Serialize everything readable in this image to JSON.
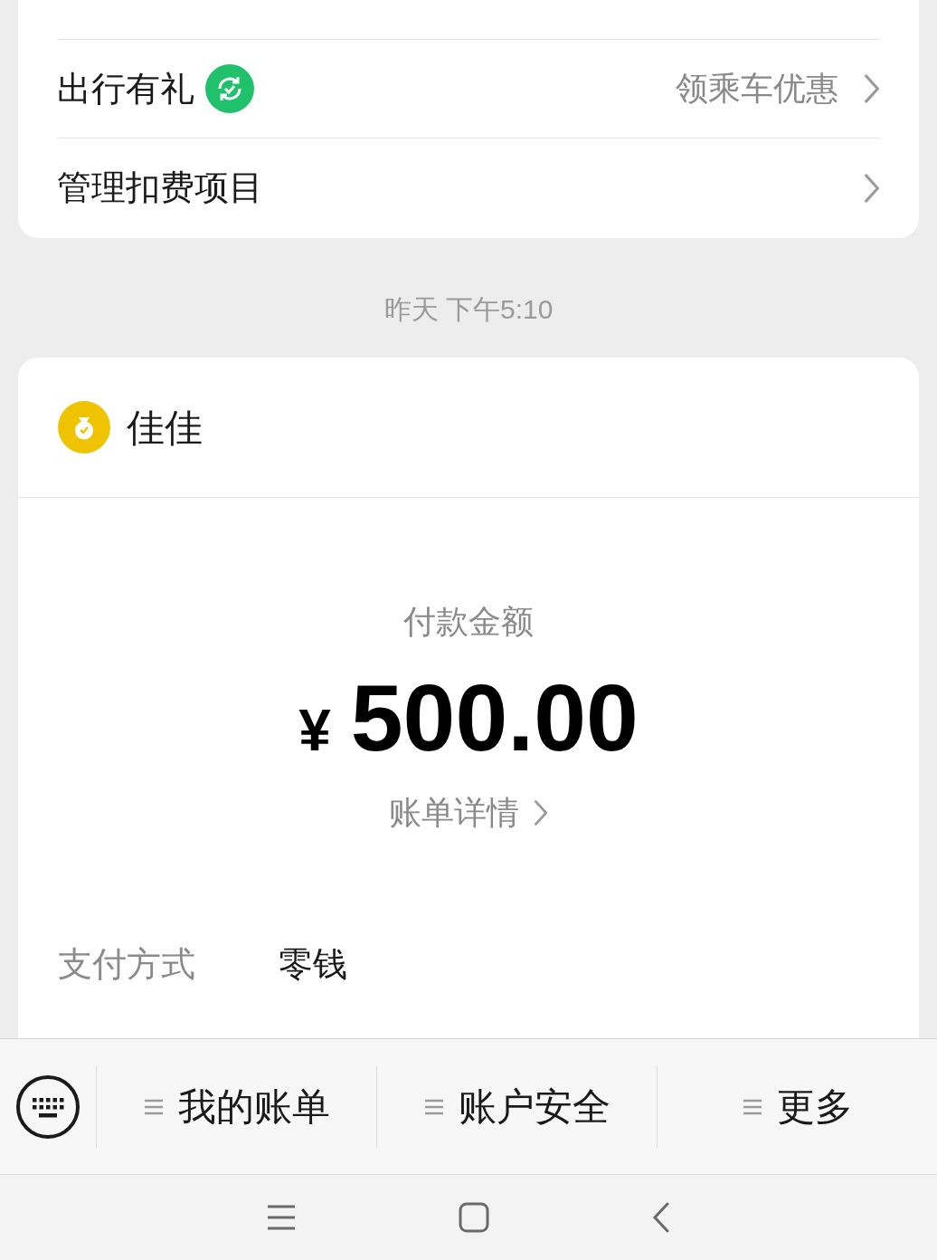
{
  "top_card": {
    "rows": [
      {
        "kind": "promo",
        "label": "出行有礼",
        "hint": "领乘车优惠"
      },
      {
        "kind": "plain",
        "label": "管理扣费项目"
      }
    ]
  },
  "timestamp": "昨天 下午5:10",
  "payment_card": {
    "merchant": "佳佳",
    "amount_label": "付款金额",
    "currency": "¥",
    "amount": "500.00",
    "details_link": "账单详情",
    "method_label": "支付方式",
    "method_value": "零钱"
  },
  "menu_bar": {
    "items": [
      "我的账单",
      "账户安全",
      "更多"
    ]
  }
}
